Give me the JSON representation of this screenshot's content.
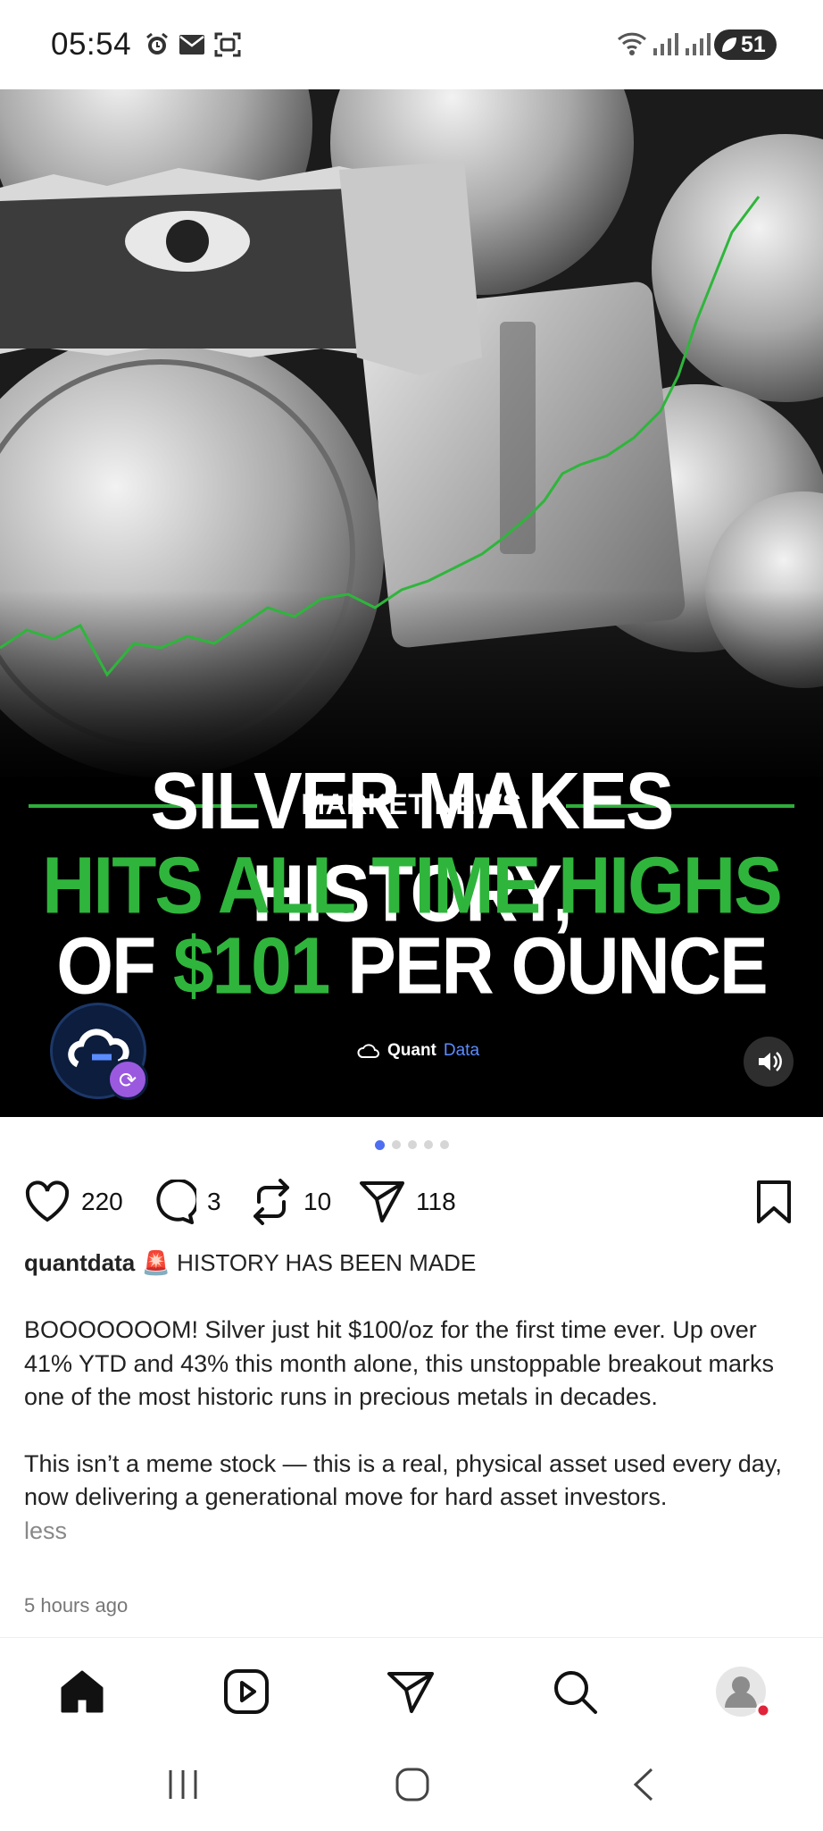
{
  "status_bar": {
    "time": "05:54",
    "battery": "51",
    "icons": [
      "alarm-icon",
      "mail-icon",
      "screenshot-icon",
      "wifi-icon",
      "signal-icon",
      "signal-icon"
    ]
  },
  "post_image": {
    "category": "MARKET NEWS",
    "headline_line1": "SILVER MAKES HISTORY,",
    "headline_line2": "HITS ALL TIME HIGHS",
    "headline_line3_a": "OF ",
    "headline_line3_price": "$101",
    "headline_line3_b": " PER OUNCE",
    "brand_name": "Quant",
    "brand_suffix": "Data",
    "accent_color": "#2fb53c"
  },
  "carousel": {
    "pages": 5,
    "active": 1
  },
  "actions": {
    "likes": "220",
    "comments": "3",
    "reposts": "10",
    "shares": "118"
  },
  "caption": {
    "username": "quantdata",
    "emoji": "🚨",
    "title": "HISTORY HAS BEEN MADE"
  },
  "body": {
    "paragraph1": "BOOOOOOOM! Silver just hit $100/oz for the first time ever. Up over 41% YTD and 43% this month alone, this unstoppable breakout marks one of the most historic runs in precious metals in decades.",
    "paragraph2": "This isn’t a meme stock — this is a real, physical asset used every day, now delivering a generational move for hard asset investors.",
    "less_label": "less"
  },
  "time_ago": "5 hours ago",
  "nav": {
    "items": [
      "home-icon",
      "reels-icon",
      "send-icon",
      "search-icon",
      "profile-avatar"
    ]
  }
}
